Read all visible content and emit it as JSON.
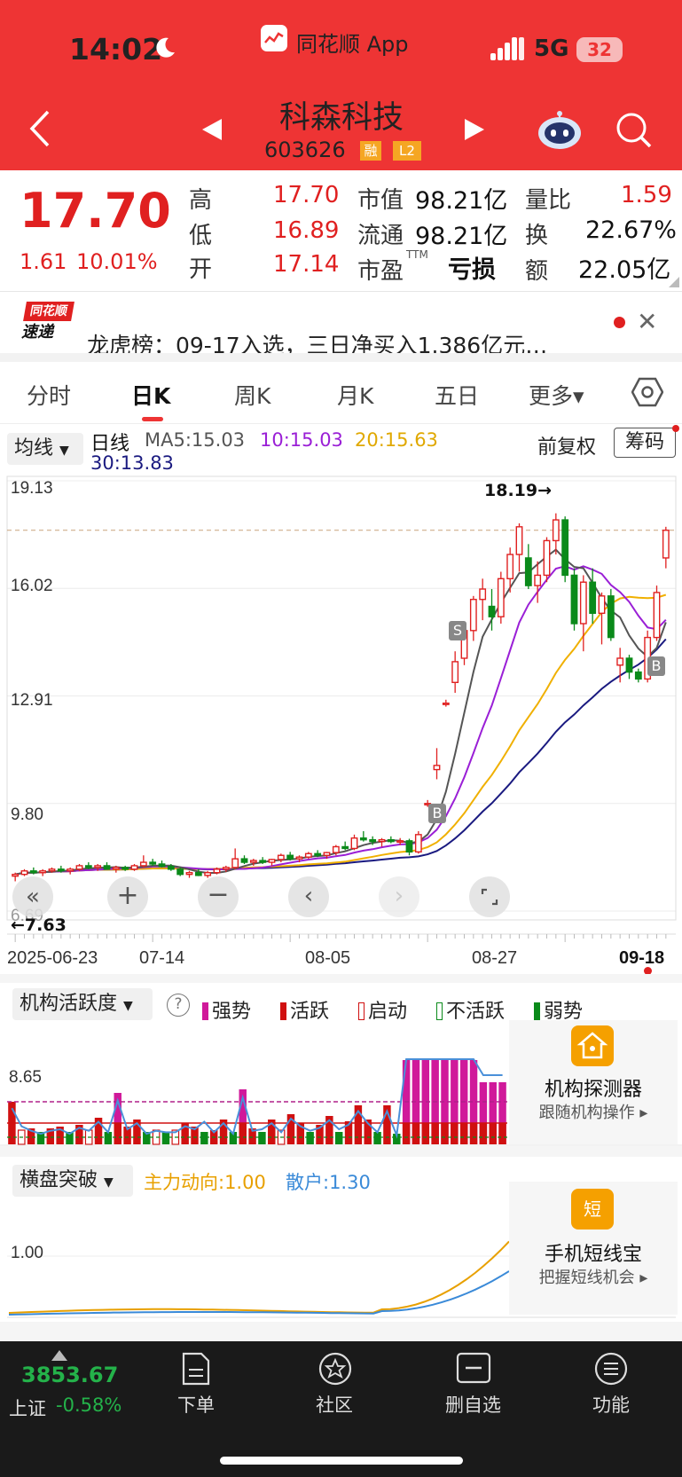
{
  "status_bar": {
    "time": "14:02",
    "app_name": "同花顺 App",
    "network": "5G",
    "battery": "32"
  },
  "stock": {
    "name": "科森科技",
    "code": "603626",
    "tag_margin": "融",
    "tag_l2": "L2"
  },
  "quote": {
    "price": "17.70",
    "change": "1.61",
    "change_pct": "10.01%",
    "high_label": "高",
    "high": "17.70",
    "low_label": "低",
    "low": "16.89",
    "open_label": "开",
    "open": "17.14",
    "mcap_label": "市值",
    "mcap": "98.21亿",
    "float_label": "流通",
    "float": "98.21亿",
    "pe_label": "市盈",
    "pe_sup": "TTM",
    "pe": "亏损",
    "vol_ratio_label": "量比",
    "vol_ratio": "1.59",
    "turnover_label": "换",
    "turnover": "22.67%",
    "amount_label": "额",
    "amount": "22.05亿"
  },
  "news": {
    "logo_top": "同花顺",
    "logo_bottom": "速递",
    "text": "龙虎榜：09-17入选，三日净买入1.386亿元…"
  },
  "tabs": [
    {
      "label": "分时"
    },
    {
      "label": "日K"
    },
    {
      "label": "周K"
    },
    {
      "label": "月K"
    },
    {
      "label": "五日"
    },
    {
      "label": "更多▾"
    }
  ],
  "kline": {
    "ma_selector": "均线",
    "legend_title": "日线",
    "ma5": "MA5:15.03",
    "ma10": "10:15.03",
    "ma20": "20:15.63",
    "ma30": "30:13.83",
    "adjust_label": "前复权",
    "chip_button": "筹码",
    "colors": {
      "up": "#e02020",
      "down": "#0a8a1a",
      "ma5": "#555555",
      "ma10": "#9a1fd6",
      "ma20": "#f0b000",
      "ma30": "#1a1a80"
    }
  },
  "chart_data": {
    "type": "candlestick",
    "y_ticks": [
      "19.13",
      "16.02",
      "12.91",
      "9.80",
      "6.69"
    ],
    "x_labels": [
      "2025-06-23",
      "07-14",
      "08-05",
      "08-27",
      "09-18"
    ],
    "ylim": [
      6.69,
      19.13
    ],
    "max_annotation": "18.19→",
    "min_annotation": "←7.63",
    "buy_marker": "B",
    "sell_marker": "S",
    "candles": [
      [
        7.7,
        7.8,
        7.55,
        7.75
      ],
      [
        7.75,
        7.9,
        7.7,
        7.85
      ],
      [
        7.85,
        7.95,
        7.75,
        7.8
      ],
      [
        7.8,
        7.9,
        7.7,
        7.85
      ],
      [
        7.85,
        7.95,
        7.8,
        7.9
      ],
      [
        7.9,
        8.0,
        7.8,
        7.85
      ],
      [
        7.85,
        7.95,
        7.75,
        7.9
      ],
      [
        7.9,
        8.05,
        7.85,
        8.0
      ],
      [
        8.0,
        8.1,
        7.9,
        7.95
      ],
      [
        7.95,
        8.05,
        7.85,
        8.0
      ],
      [
        8.0,
        8.1,
        7.9,
        7.9
      ],
      [
        7.9,
        8.0,
        7.8,
        7.95
      ],
      [
        7.95,
        8.0,
        7.85,
        7.9
      ],
      [
        7.9,
        8.05,
        7.85,
        8.0
      ],
      [
        8.0,
        8.3,
        7.95,
        8.1
      ],
      [
        8.1,
        8.2,
        8.0,
        8.05
      ],
      [
        8.05,
        8.15,
        7.95,
        7.98
      ],
      [
        7.98,
        8.05,
        7.85,
        7.9
      ],
      [
        7.9,
        7.95,
        7.7,
        7.75
      ],
      [
        7.75,
        7.85,
        7.65,
        7.8
      ],
      [
        7.8,
        7.9,
        7.7,
        7.72
      ],
      [
        7.72,
        7.85,
        7.65,
        7.8
      ],
      [
        7.8,
        7.95,
        7.75,
        7.9
      ],
      [
        7.9,
        8.0,
        7.82,
        7.95
      ],
      [
        7.95,
        8.5,
        7.9,
        8.2
      ],
      [
        8.2,
        8.3,
        8.05,
        8.1
      ],
      [
        8.1,
        8.2,
        8.0,
        8.15
      ],
      [
        8.15,
        8.25,
        8.05,
        8.1
      ],
      [
        8.1,
        8.2,
        8.0,
        8.18
      ],
      [
        8.18,
        8.35,
        8.1,
        8.3
      ],
      [
        8.3,
        8.4,
        8.15,
        8.2
      ],
      [
        8.2,
        8.3,
        8.1,
        8.25
      ],
      [
        8.25,
        8.4,
        8.2,
        8.35
      ],
      [
        8.35,
        8.45,
        8.25,
        8.3
      ],
      [
        8.3,
        8.4,
        8.2,
        8.38
      ],
      [
        8.38,
        8.6,
        8.3,
        8.55
      ],
      [
        8.55,
        8.7,
        8.45,
        8.5
      ],
      [
        8.5,
        8.9,
        8.45,
        8.8
      ],
      [
        8.8,
        9.0,
        8.7,
        8.75
      ],
      [
        8.75,
        8.85,
        8.6,
        8.7
      ],
      [
        8.7,
        8.8,
        8.55,
        8.75
      ],
      [
        8.75,
        8.85,
        8.65,
        8.7
      ],
      [
        8.7,
        8.8,
        8.6,
        8.72
      ],
      [
        8.72,
        8.78,
        8.3,
        8.4
      ],
      [
        8.4,
        9.0,
        8.35,
        8.9
      ],
      [
        9.8,
        9.9,
        9.7,
        9.8
      ],
      [
        10.78,
        11.4,
        10.5,
        10.9
      ],
      [
        12.7,
        12.8,
        12.6,
        12.7
      ],
      [
        13.3,
        14.2,
        13.0,
        13.9
      ],
      [
        14.0,
        15.0,
        13.8,
        14.8
      ],
      [
        14.8,
        15.8,
        14.5,
        15.7
      ],
      [
        15.7,
        16.3,
        15.1,
        16.0
      ],
      [
        15.5,
        16.0,
        14.8,
        15.2
      ],
      [
        15.2,
        16.5,
        15.0,
        16.3
      ],
      [
        16.3,
        17.2,
        15.9,
        17.0
      ],
      [
        17.0,
        17.9,
        16.5,
        17.8
      ],
      [
        16.9,
        17.3,
        16.0,
        16.1
      ],
      [
        16.1,
        16.8,
        15.6,
        16.4
      ],
      [
        16.4,
        17.5,
        16.2,
        17.4
      ],
      [
        17.4,
        18.19,
        17.0,
        18.0
      ],
      [
        18.0,
        18.1,
        16.2,
        16.4
      ],
      [
        16.4,
        16.6,
        14.8,
        15.0
      ],
      [
        15.0,
        16.4,
        14.2,
        16.2
      ],
      [
        16.2,
        16.6,
        15.0,
        15.3
      ],
      [
        15.3,
        15.9,
        14.4,
        15.8
      ],
      [
        15.8,
        16.0,
        14.5,
        14.6
      ],
      [
        13.8,
        14.3,
        13.3,
        14.0
      ],
      [
        14.0,
        14.1,
        13.4,
        13.6
      ],
      [
        13.6,
        13.7,
        13.3,
        13.4
      ],
      [
        13.4,
        14.8,
        13.3,
        14.6
      ],
      [
        14.6,
        16.1,
        14.5,
        15.9
      ],
      [
        16.9,
        17.8,
        16.6,
        17.7
      ]
    ]
  },
  "inst_panel": {
    "selector": "机构活跃度",
    "help": "?",
    "legend": [
      {
        "label": "强势",
        "color": "#d0199a"
      },
      {
        "label": "活跃",
        "color": "#d01010"
      },
      {
        "label": "启动",
        "color": "#d01010"
      },
      {
        "label": "不活跃",
        "color": "#0a8a1a"
      },
      {
        "label": "弱势",
        "color": "#0a8a1a"
      }
    ],
    "y_tick": "8.65",
    "promo_title": "机构探测器",
    "promo_sub": "跟随机构操作 ▸"
  },
  "breakout_panel": {
    "selector": "横盘突破",
    "main_force": "主力动向:1.00",
    "retail": "散户:1.30",
    "y_tick": "1.00",
    "promo_title": "手机短线宝",
    "promo_sub": "把握短线机会 ▸",
    "promo_badge": "短"
  },
  "bottom_nav": {
    "index_value": "3853.67",
    "index_name": "上证",
    "index_change": "-0.58%",
    "items": [
      {
        "label": "下单"
      },
      {
        "label": "社区"
      },
      {
        "label": "删自选"
      },
      {
        "label": "功能"
      }
    ]
  }
}
